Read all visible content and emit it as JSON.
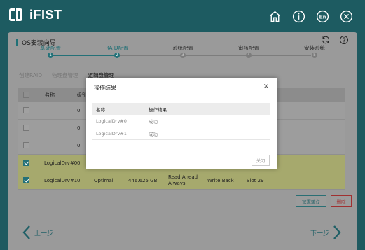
{
  "app": {
    "name": "iFIST"
  },
  "top_icons": [
    {
      "name": "home-icon"
    },
    {
      "name": "info-icon"
    },
    {
      "name": "language-icon",
      "label": "En"
    },
    {
      "name": "close-icon"
    }
  ],
  "panel": {
    "title": "OS安装向导"
  },
  "steps": [
    {
      "label": "基础配置",
      "num": "1"
    },
    {
      "label": "RAID配置",
      "num": "2"
    },
    {
      "label": "系统配置",
      "num": "3"
    },
    {
      "label": "审核配置",
      "num": "4"
    },
    {
      "label": "安装系统",
      "num": "5"
    }
  ],
  "subtabs": [
    {
      "label": "创建RAID"
    },
    {
      "label": "物理盘管理"
    },
    {
      "label": "逻辑盘管理"
    }
  ],
  "table": {
    "headers": {
      "name": "名称",
      "col2": "级别"
    },
    "rows": [
      {
        "name": "",
        "level": "0",
        "status": "",
        "capacity": "",
        "cache_read": "",
        "cache_write": "",
        "slot": "",
        "checked": false
      },
      {
        "name": "",
        "level": "0",
        "status": "",
        "capacity": "",
        "cache_read": "",
        "cache_write": "",
        "slot": "",
        "checked": false
      },
      {
        "name": "",
        "level": "0",
        "status": "",
        "capacity": "",
        "cache_read": "",
        "cache_write": "",
        "slot": "",
        "checked": false
      },
      {
        "name": "LogicalDrv#0",
        "level": "0",
        "status": "",
        "capacity": "",
        "cache_read": "",
        "cache_write": "",
        "slot": "",
        "checked": true
      },
      {
        "name": "LogicalDrv#1",
        "level": "0",
        "status": "Optimal",
        "capacity": "446.625 GB",
        "cache_read": "Read Ahead Always",
        "cache_write": "Write Back",
        "slot": "Slot 29",
        "checked": true
      }
    ]
  },
  "buttons": {
    "save": "设置缓存",
    "delete": "删除"
  },
  "nav": {
    "prev": "上一步",
    "next": "下一步"
  },
  "modal": {
    "title": "操作结果",
    "close_symbol": "×",
    "headers": {
      "name": "名称",
      "result": "操作结果"
    },
    "rows": [
      {
        "name": "LogicalDrv#0",
        "result": "成功"
      },
      {
        "name": "LogicalDrv#1",
        "result": "成功"
      }
    ],
    "button": "关闭"
  },
  "colors": {
    "topbar": "#1d5b61",
    "accent": "#247178",
    "delete": "#a03030",
    "selected_row": "#a6a96d"
  }
}
